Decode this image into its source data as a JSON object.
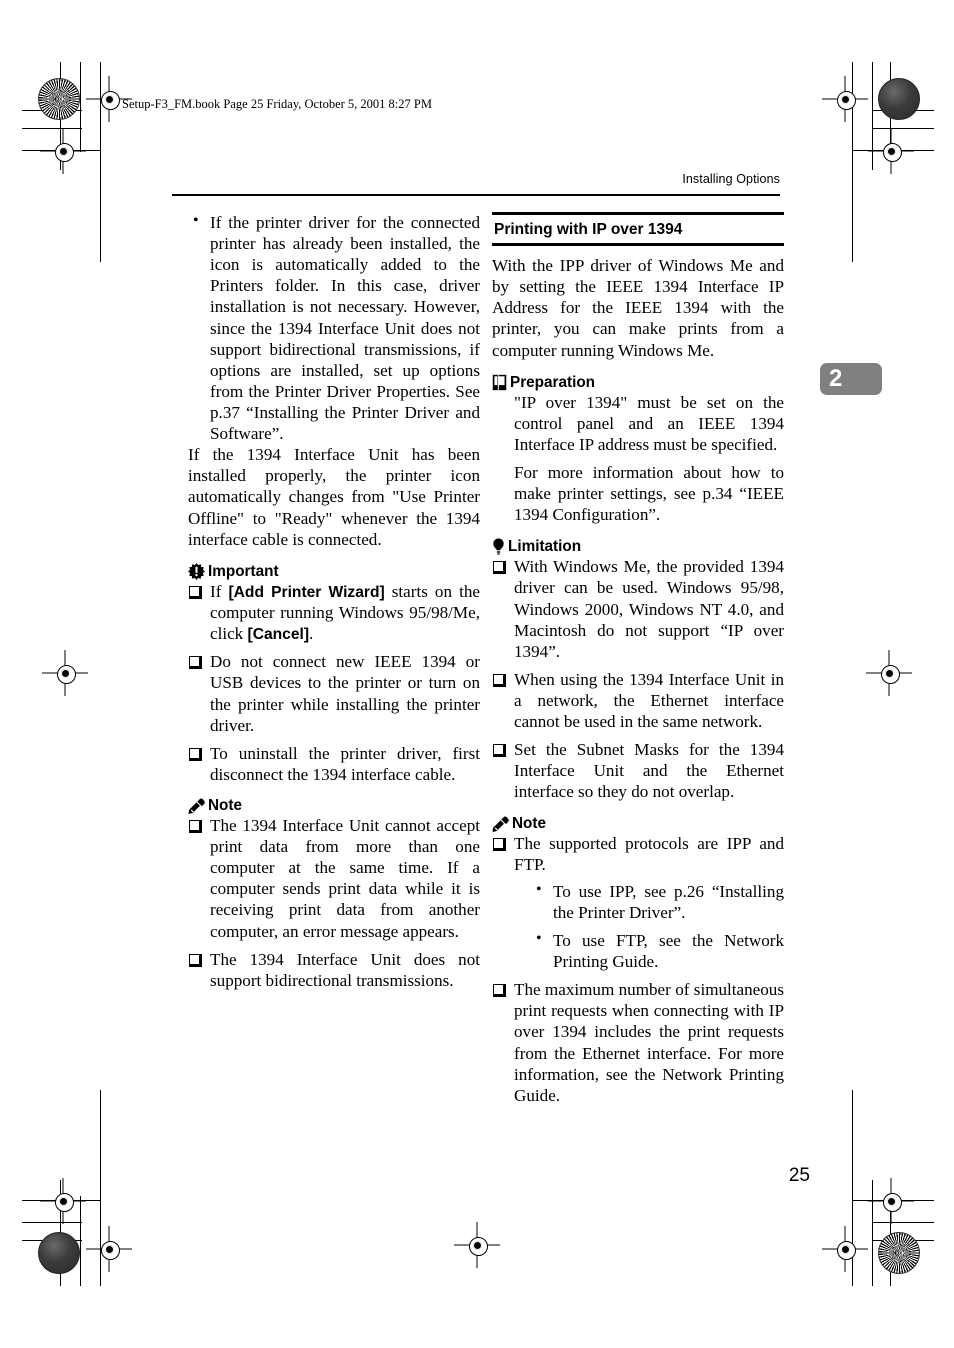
{
  "file_stamp": "Setup-F3_FM.book  Page 25  Friday, October 5, 2001  8:27 PM",
  "running_head": "Installing Options",
  "chapter_tab": "2",
  "page_number": "25",
  "colors": {
    "chapter_tab_bg": "#808080",
    "chapter_tab_text": "#ffffff",
    "rule": "#000000",
    "body_text": "#000000"
  },
  "left_column": {
    "bullet_item": "If the printer driver for the connected printer has already been installed, the icon is automatically added to the Printers folder. In this case, driver installation is not necessary. However, since the 1394 Interface Unit does not support bidirectional transmissions, if options are installed, set up options from the Printer Driver Properties. See p.37 “Installing the Printer Driver and Software”.",
    "paragraph": "If the 1394 Interface Unit has been installed properly, the printer icon automatically changes from \"Use Printer Offline\" to \"Ready\" whenever the 1394 interface cable is connected.",
    "important": {
      "icon": "important-burst-icon",
      "label": "Important",
      "items": [
        {
          "parts": [
            {
              "text": "If ",
              "style": "normal"
            },
            {
              "text": "[Add Printer Wizard]",
              "style": "ui"
            },
            {
              "text": " starts on the computer running Windows 95/98/Me, click ",
              "style": "normal"
            },
            {
              "text": "[Cancel]",
              "style": "ui"
            },
            {
              "text": ".",
              "style": "normal"
            }
          ]
        },
        {
          "parts": [
            {
              "text": "Do not connect new IEEE 1394 or USB devices to the printer or turn on the printer while installing the printer driver.",
              "style": "normal"
            }
          ]
        },
        {
          "parts": [
            {
              "text": "To uninstall the printer driver, first disconnect the 1394 interface cable.",
              "style": "normal"
            }
          ]
        }
      ]
    },
    "note": {
      "icon": "note-pencil-icon",
      "label": "Note",
      "items": [
        "The 1394 Interface Unit cannot accept print data from more than one computer at the same time. If a computer sends print data while it is receiving print data from another computer, an error message appears.",
        "The 1394 Interface Unit does not support bidirectional transmissions."
      ]
    }
  },
  "right_column": {
    "section_heading": "Printing with IP over 1394",
    "intro": "With the IPP driver of Windows Me and by setting the IEEE 1394 Interface IP Address for the IEEE 1394 with the printer, you can make prints from a computer running Windows Me.",
    "preparation": {
      "icon": "preparation-book-icon",
      "label": "Preparation",
      "paragraphs": [
        "\"IP over 1394\" must be set on the control panel and an IEEE 1394 Interface IP address must be specified.",
        "For more information about how to make printer settings, see p.34 “IEEE 1394 Configuration”."
      ]
    },
    "limitation": {
      "icon": "limitation-bulb-icon",
      "label": "Limitation",
      "items": [
        "With Windows Me, the provided 1394 driver can be used. Windows 95/98, Windows 2000, Windows NT 4.0, and Macintosh do not support “IP over 1394”.",
        "When using the 1394 Interface Unit in a network, the Ethernet interface cannot be used in the same network.",
        "Set the Subnet Masks for the 1394 Interface Unit and the Ethernet interface so they do not overlap."
      ]
    },
    "note": {
      "icon": "note-pencil-icon",
      "label": "Note",
      "item_protocols": "The supported protocols are IPP and FTP.",
      "sub_items": [
        "To use IPP, see p.26 “Installing the Printer Driver”.",
        "To use FTP, see the Network Printing Guide."
      ],
      "item_max": "The maximum number of simultaneous print requests when connecting with IP over 1394 includes the print requests from the Ethernet interface. For more information, see the Network Printing Guide."
    }
  }
}
